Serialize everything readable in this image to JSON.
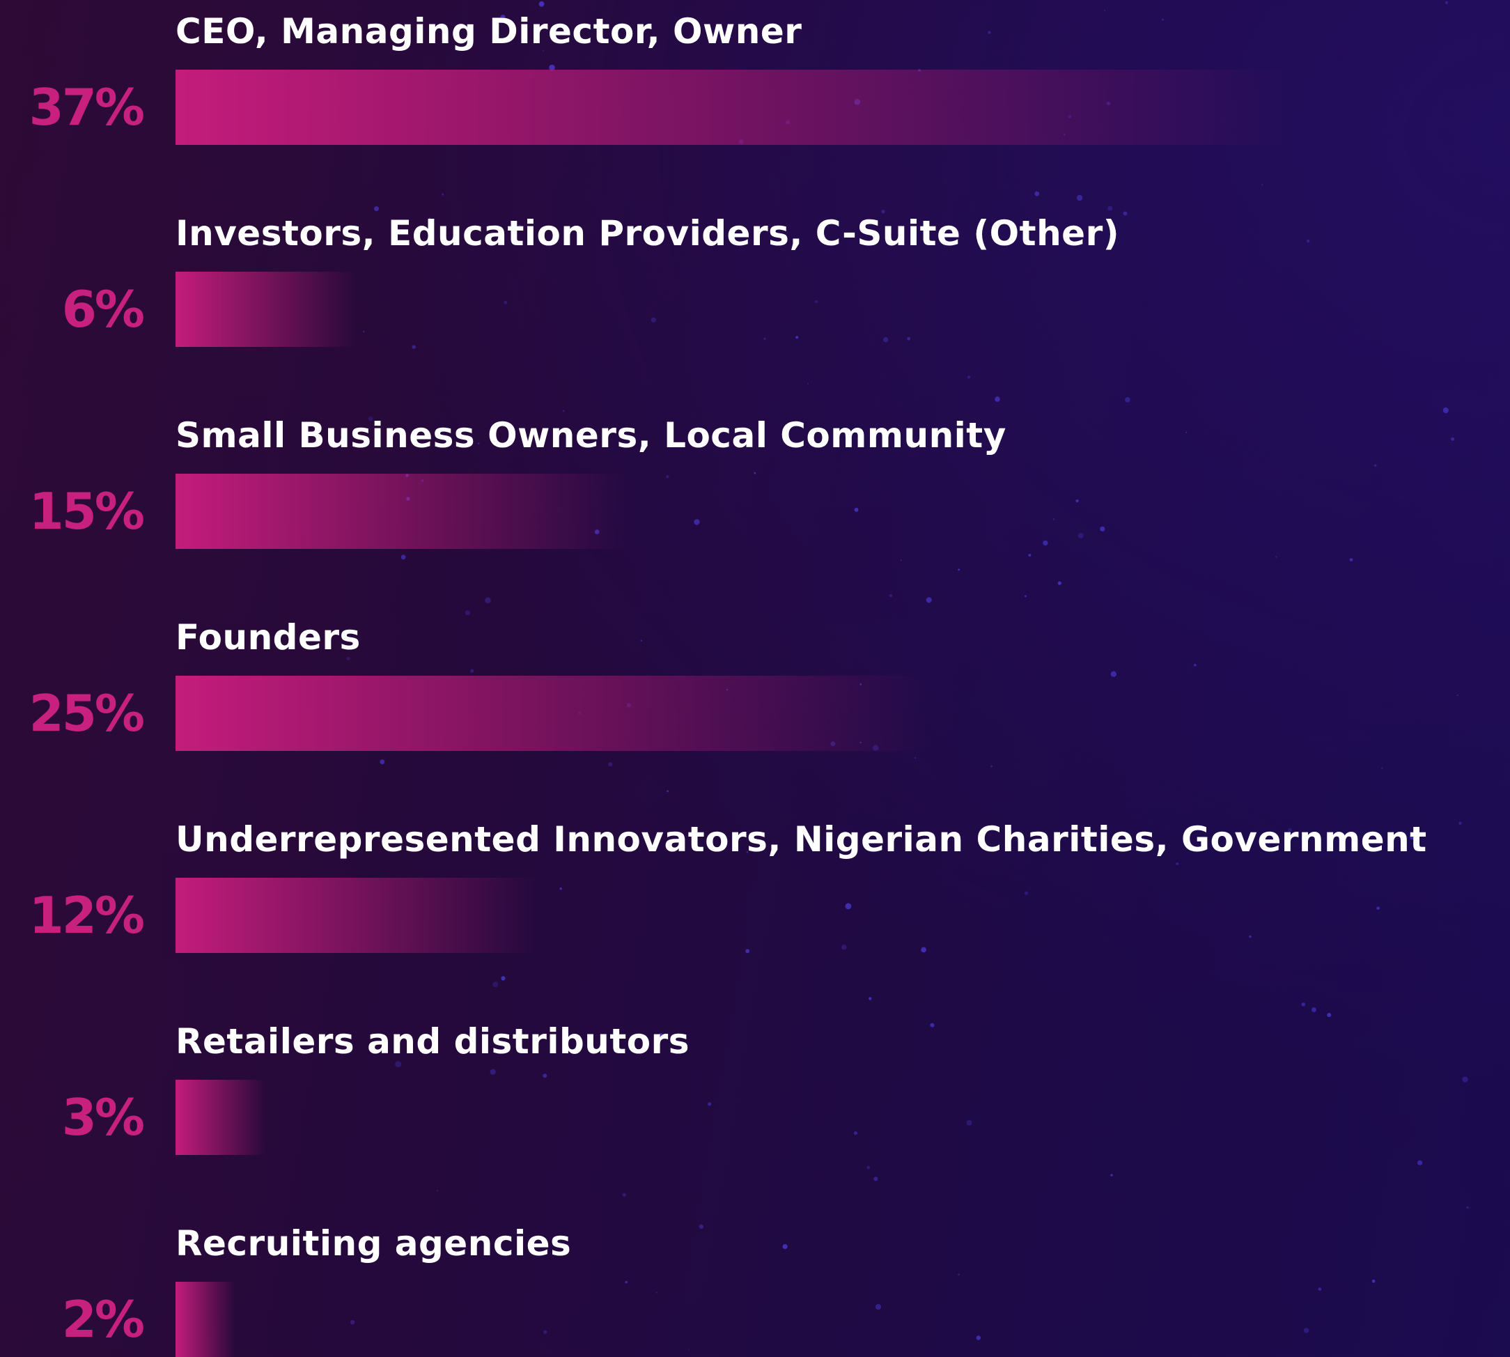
{
  "colors": {
    "bar_start": "#c41c7c",
    "percent_text": "#c8207e",
    "label_text": "#ffffff",
    "background_left": "#2e0a36",
    "background_right": "#1b0b4f",
    "star": "#4a3bd6"
  },
  "chart_data": {
    "type": "bar",
    "orientation": "horizontal",
    "unit": "%",
    "max_value": 37,
    "categories": [
      "CEO, Managing Director, Owner",
      "Investors, Education Providers, C-Suite (Other)",
      "Small Business Owners, Local Community",
      "Founders",
      "Underrepresented Innovators, Nigerian Charities, Government",
      "Retailers and distributors",
      "Recruiting agencies"
    ],
    "values": [
      37,
      6,
      15,
      25,
      12,
      3,
      2
    ],
    "value_labels": [
      "37%",
      "6%",
      "15%",
      "25%",
      "12%",
      "3%",
      "2%"
    ],
    "grid": false,
    "legend": "none"
  }
}
